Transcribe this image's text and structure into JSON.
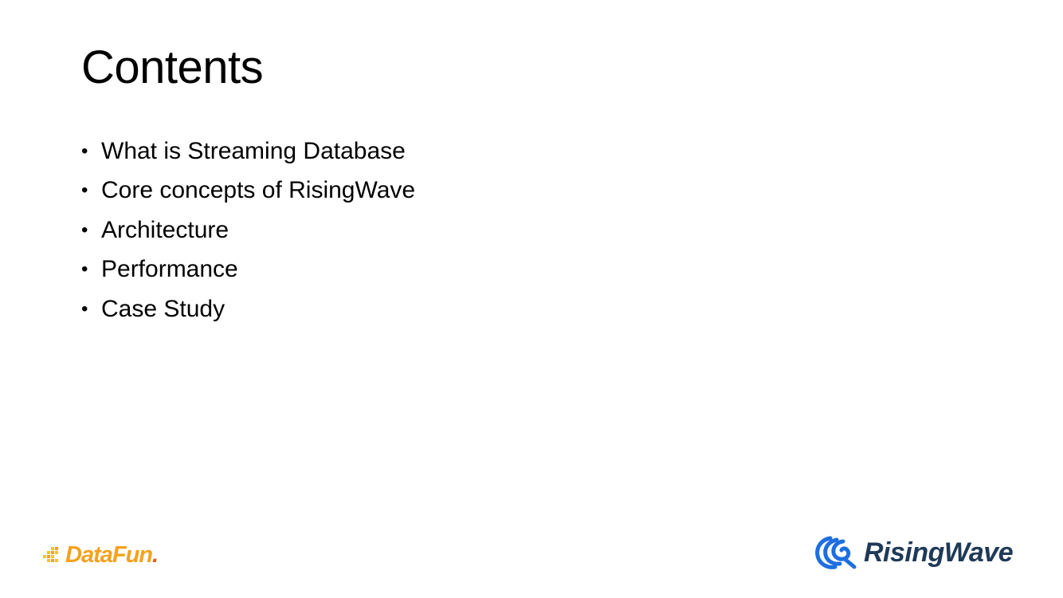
{
  "slide": {
    "title": "Contents",
    "bullets": [
      "What is Streaming Database",
      "Core concepts of RisingWave",
      "Architecture",
      "Performance",
      "Case Study"
    ],
    "bullet_glyph": "•"
  },
  "logos": {
    "left": {
      "text_main": "DataFun",
      "text_dot": ".",
      "colors": {
        "primary": "#f5a11c",
        "accent": "#e95f1a"
      },
      "icon": "pixel-squares-icon"
    },
    "right": {
      "text": "RisingWave",
      "colors": {
        "wave": "#1d6fe0",
        "text": "#1f3a57"
      },
      "icon": "wave-icon"
    }
  }
}
